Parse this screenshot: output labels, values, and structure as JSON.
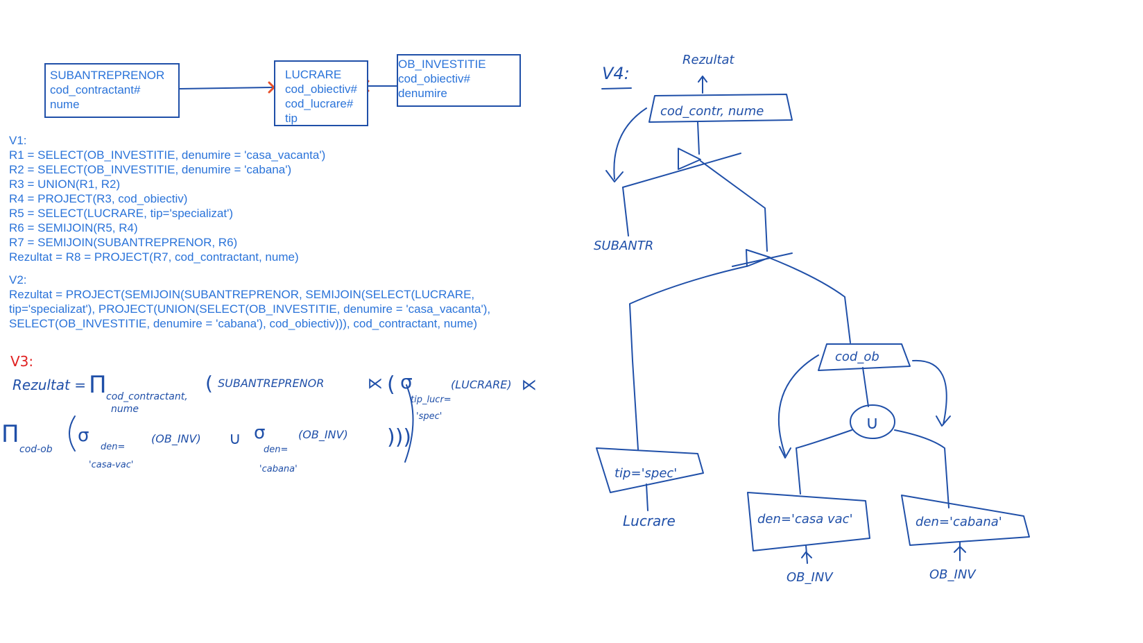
{
  "entities": {
    "subantreprenor": {
      "name": "SUBANTREPRENOR",
      "attrs": [
        "cod_contractant#",
        "nume"
      ]
    },
    "lucrare": {
      "name": "LUCRARE",
      "attrs": [
        "cod_obiectiv#",
        "cod_lucrare#",
        "tip"
      ]
    },
    "ob_investitie": {
      "name": "OB_INVESTITIE",
      "attrs": [
        "cod_obiectiv#",
        "denumire"
      ]
    }
  },
  "v1": {
    "title": "V1:",
    "lines": [
      "R1 = SELECT(OB_INVESTITIE, denumire = 'casa_vacanta')",
      "R2 = SELECT(OB_INVESTITIE, denumire = 'cabana')",
      "R3 = UNION(R1, R2)",
      "R4 = PROJECT(R3, cod_obiectiv)",
      "R5 = SELECT(LUCRARE, tip='specializat')",
      "R6 = SEMIJOIN(R5, R4)",
      "R7 = SEMIJOIN(SUBANTREPRENOR, R6)",
      "Rezultat = R8 = PROJECT(R7, cod_contractant, nume)"
    ]
  },
  "v2": {
    "title": "V2:",
    "lines": [
      "Rezultat = PROJECT(SEMIJOIN(SUBANTREPRENOR, SEMIJOIN(SELECT(LUCRARE,",
      "tip='specializat'), PROJECT(UNION(SELECT(OB_INVESTITIE, denumire = 'casa_vacanta'),",
      "SELECT(OB_INVESTITIE, denumire = 'cabana'), cod_obiectiv))), cod_contractant, nume)"
    ]
  },
  "v3": {
    "title": "V3:",
    "title_color": "#e02020",
    "line1": {
      "rezultat": "Rezultat =",
      "pi": "Π",
      "proj_sub": "cod_contractant,",
      "proj_sub2": "nume",
      "open": "(",
      "sub": "SUBANTREPRENOR",
      "semijoin": "⋉",
      "sigma": "σ",
      "sel_sub": "tip_lucr=",
      "sel_val": "'spec'",
      "lucrare": "(LUCRARE)",
      "semijoin2": "⋉"
    },
    "line2": {
      "pi": "Π",
      "proj_sub": "cod-ob",
      "sigma1": "σ",
      "cond1": "den=",
      "val1": "'casa-vac'",
      "rel1": "(OB_INV)",
      "union": "∪",
      "sigma2": "σ",
      "cond2": "den=",
      "val2": "'cabana'",
      "rel2": "(OB_INV)",
      "close": ")))"
    }
  },
  "v4": {
    "title": "V4:",
    "result": "Rezultat",
    "top_project": "cod_contr, nume",
    "subantr": "SUBANTR",
    "mid_project": "cod_ob",
    "union": "∪",
    "select_tip": "tip='spec'",
    "lucrare": "Lucrare",
    "select_casa": "den='casa vac'",
    "select_cabana": "den='cabana'",
    "obinv1": "OB_INV",
    "obinv2": "OB_INV"
  }
}
